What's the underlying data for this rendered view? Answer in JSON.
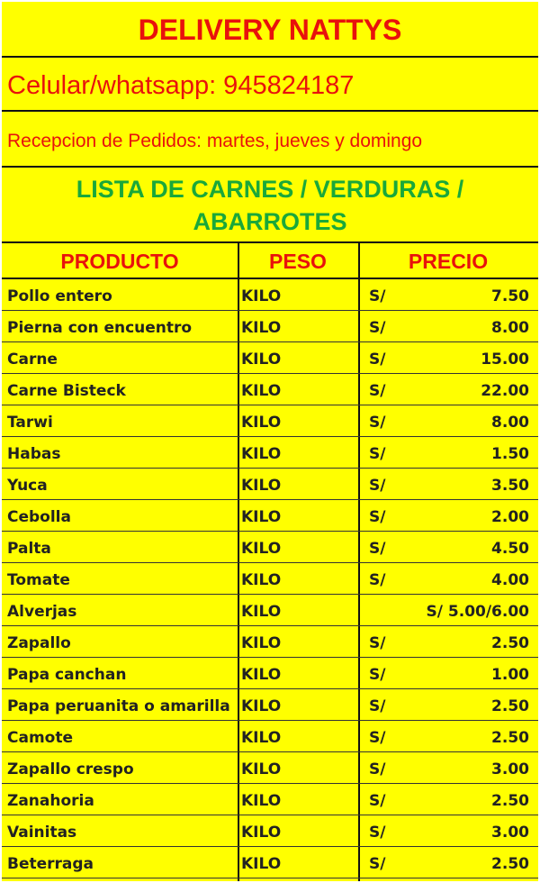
{
  "header": {
    "title": "DELIVERY NATTYS",
    "phone": "Celular/whatsapp: 945824187",
    "reception": "Recepcion de Pedidos: martes, jueves y domingo",
    "list_line1": "LISTA DE CARNES / VERDURAS /",
    "list_line2": "ABARROTES"
  },
  "table": {
    "columns": [
      "PRODUCTO",
      "PESO",
      "PRECIO"
    ],
    "currency": "S/",
    "rows": [
      {
        "product": "Pollo entero",
        "unit": "KILO",
        "price": "7.50"
      },
      {
        "product": "Pierna con encuentro",
        "unit": "KILO",
        "price": "8.00"
      },
      {
        "product": "Carne",
        "unit": "KILO",
        "price": "15.00"
      },
      {
        "product": "Carne Bisteck",
        "unit": "KILO",
        "price": "22.00"
      },
      {
        "product": "Tarwi",
        "unit": "KILO",
        "price": "8.00"
      },
      {
        "product": "Habas",
        "unit": "KILO",
        "price": "1.50"
      },
      {
        "product": "Yuca",
        "unit": "KILO",
        "price": "3.50"
      },
      {
        "product": "Cebolla",
        "unit": "KILO",
        "price": "2.00"
      },
      {
        "product": "Palta",
        "unit": "KILO",
        "price": "4.50"
      },
      {
        "product": "Tomate",
        "unit": "KILO",
        "price": "4.00"
      },
      {
        "product": "Alverjas",
        "unit": "KILO",
        "price": "S/  5.00/6.00"
      },
      {
        "product": "Zapallo",
        "unit": "KILO",
        "price": "2.50"
      },
      {
        "product": "Papa canchan",
        "unit": "KILO",
        "price": "1.00"
      },
      {
        "product": "Papa peruanita o amarilla",
        "unit": "KILO",
        "price": "2.50"
      },
      {
        "product": "Camote",
        "unit": "KILO",
        "price": "2.50"
      },
      {
        "product": "Zapallo crespo",
        "unit": "KILO",
        "price": "3.00"
      },
      {
        "product": "Zanahoria",
        "unit": "KILO",
        "price": "2.50"
      },
      {
        "product": "Vainitas",
        "unit": "KILO",
        "price": "3.00"
      },
      {
        "product": "Beterraga",
        "unit": "KILO",
        "price": "2.50"
      }
    ]
  },
  "colors": {
    "background": "#ffff00",
    "title_red": "#e8120c",
    "list_green": "#1aa83a"
  }
}
